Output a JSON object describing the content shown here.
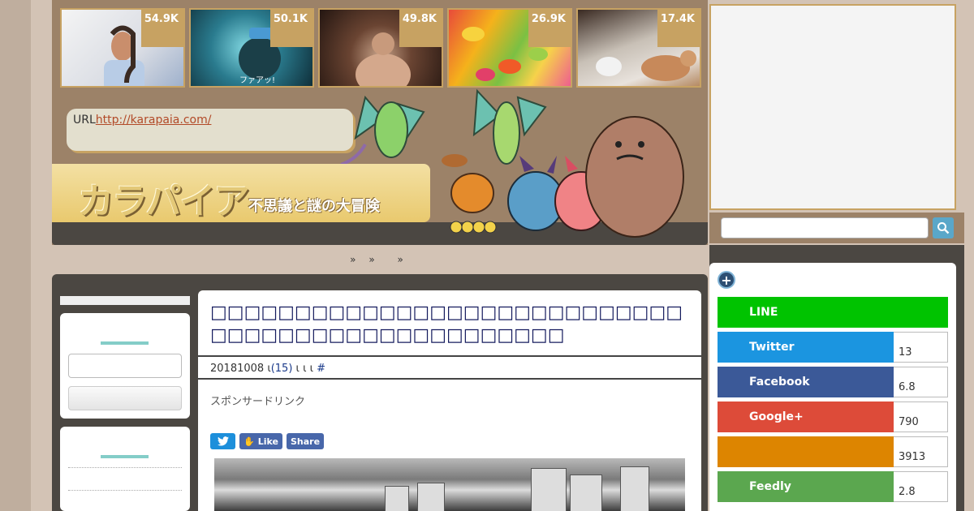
{
  "thumbnails": [
    {
      "count": "54.9K",
      "caption": ""
    },
    {
      "count": "50.1K",
      "caption": "ファアッ!"
    },
    {
      "count": "49.8K",
      "caption": ""
    },
    {
      "count": "26.9K",
      "caption": ""
    },
    {
      "count": "17.4K",
      "caption": ""
    }
  ],
  "url_box": {
    "label": "URL",
    "link": "http://karapaia.com/"
  },
  "logo": {
    "title": "カラパイア",
    "subtitle": "不思議と謎の大冒険"
  },
  "breadcrumb": [
    "»",
    "»",
    "»"
  ],
  "article": {
    "title": "□□□□□□□□□□□□□□□□□□□□□□□□□□□□□□□□□□□□□□□□□□□□□□□□□",
    "meta_date": "20181008",
    "meta_mid": "ι",
    "meta_comments": "(15)",
    "meta_tail": "ι ι  ι",
    "meta_hash": "#",
    "sponsor": "スポンサードリンク",
    "share": {
      "twitter": "",
      "like": "Like",
      "share": "Share"
    }
  },
  "right_sidebar": {
    "plus": "+",
    "sns": [
      {
        "name": "LINE",
        "count": "",
        "color": "#00c300"
      },
      {
        "name": "Twitter",
        "count": "13",
        "color": "#1b95e0"
      },
      {
        "name": "Facebook",
        "count": "6.8",
        "color": "#3b5998"
      },
      {
        "name": "Google+",
        "count": "790",
        "color": "#dd4b39"
      },
      {
        "name": "",
        "count": "3913",
        "color": "#dd8500"
      },
      {
        "name": "Feedly",
        "count": "2.8",
        "color": "#6cc655"
      }
    ]
  }
}
